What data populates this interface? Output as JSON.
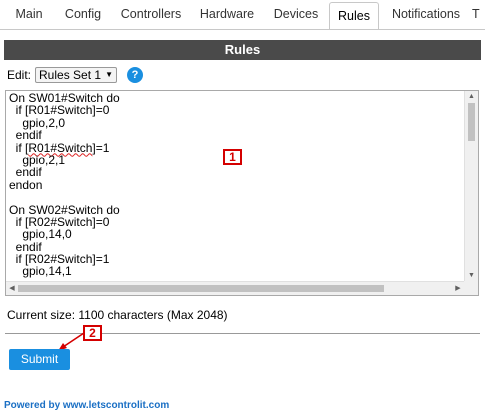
{
  "tabs": [
    {
      "label": "Main",
      "active": false
    },
    {
      "label": "Config",
      "active": false
    },
    {
      "label": "Controllers",
      "active": false
    },
    {
      "label": "Hardware",
      "active": false
    },
    {
      "label": "Devices",
      "active": false
    },
    {
      "label": "Rules",
      "active": true
    },
    {
      "label": "Notifications",
      "active": false
    },
    {
      "label": "T",
      "active": false
    }
  ],
  "header": {
    "title": "Rules"
  },
  "edit": {
    "label": "Edit:",
    "selected": "Rules Set 1",
    "help_icon": "question-mark-icon",
    "help_glyph": "?"
  },
  "editor": {
    "lines": [
      "On SW01#Switch do",
      "  if [R01#Switch]=0",
      "    gpio,2,0",
      "  endif",
      "  if [R01#Switch]=1",
      "    gpio,2,1",
      "  endif",
      "endon",
      "",
      "On SW02#Switch do",
      "  if [R02#Switch]=0",
      "    gpio,14,0",
      "  endif",
      "  if [R02#Switch]=1",
      "    gpio,14,1"
    ]
  },
  "annotations": {
    "marker1": "1",
    "marker2": "2"
  },
  "status": {
    "size_text": "Current size: 1100 characters (Max 2048)"
  },
  "submit": {
    "label": "Submit"
  },
  "footer": {
    "text": "Powered by www.letscontrolit.com"
  },
  "colors": {
    "accent": "#1a8fe0",
    "header_bg": "#4a4a4a",
    "annotation": "#d40000",
    "link": "#1a6fc4"
  }
}
